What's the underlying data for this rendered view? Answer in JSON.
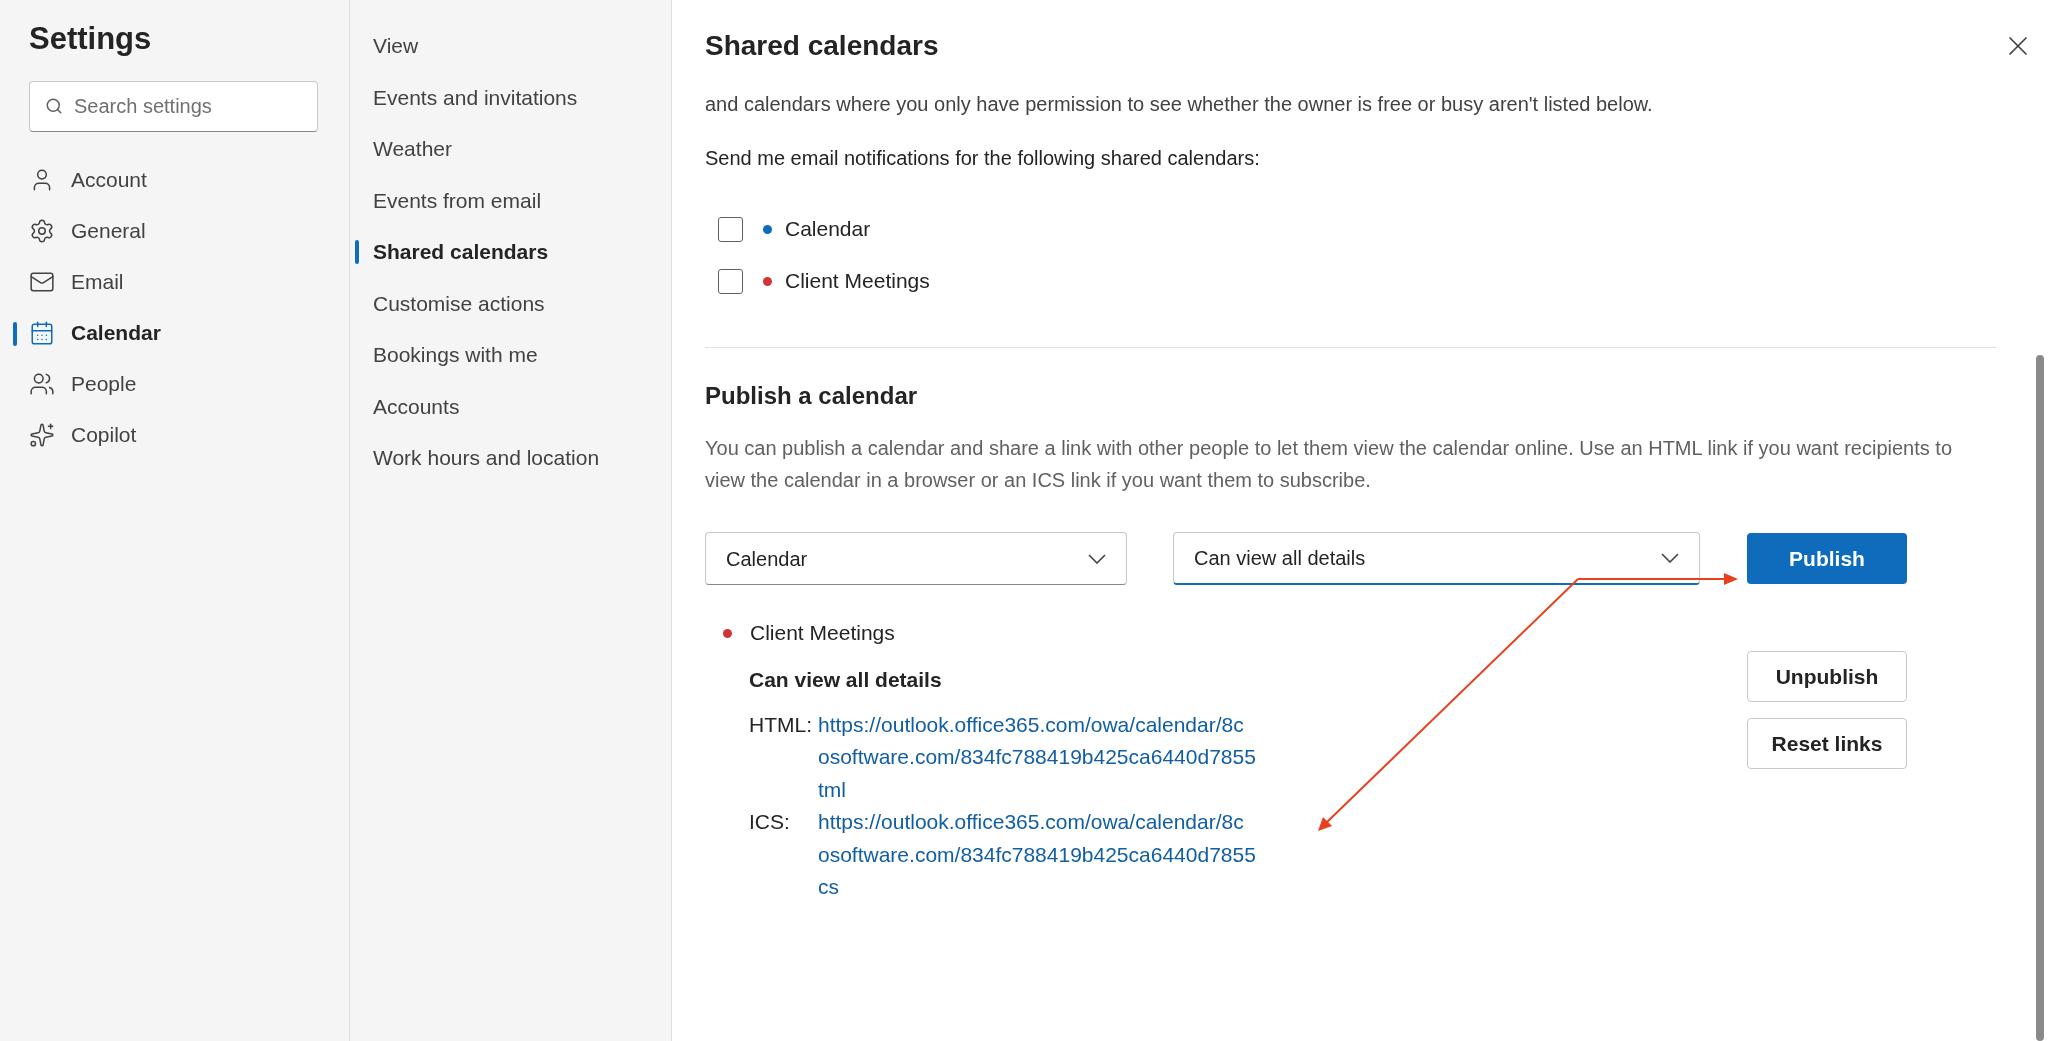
{
  "sidebar": {
    "title": "Settings",
    "search": {
      "placeholder": "Search settings"
    },
    "items": [
      {
        "label": "Account",
        "selected": false
      },
      {
        "label": "General",
        "selected": false
      },
      {
        "label": "Email",
        "selected": false
      },
      {
        "label": "Calendar",
        "selected": true
      },
      {
        "label": "People",
        "selected": false
      },
      {
        "label": "Copilot",
        "selected": false
      }
    ]
  },
  "subnav": {
    "items": [
      {
        "label": "View",
        "selected": false
      },
      {
        "label": "Events and invitations",
        "selected": false
      },
      {
        "label": "Weather",
        "selected": false
      },
      {
        "label": "Events from email",
        "selected": false
      },
      {
        "label": "Shared calendars",
        "selected": true
      },
      {
        "label": "Customise actions",
        "selected": false
      },
      {
        "label": "Bookings with me",
        "selected": false
      },
      {
        "label": "Accounts",
        "selected": false
      },
      {
        "label": "Work hours and location",
        "selected": false
      }
    ]
  },
  "panel": {
    "title": "Shared calendars",
    "notifications": {
      "intro_lines": [
        "and calendars where you only have permission to see whether the owner is free or busy aren't listed below."
      ],
      "prompt": "Send me email notifications for the following shared calendars:",
      "calendars": [
        {
          "name": "Calendar",
          "checked": false,
          "color": "#0f6cbd"
        },
        {
          "name": "Client Meetings",
          "checked": false,
          "color": "#d13438"
        }
      ]
    },
    "publish": {
      "heading": "Publish a calendar",
      "description": "You can publish a calendar and share a link with other people to let them view the calendar online. Use an HTML link if you want recipients to view the calendar in a browser or an ICS link if you want them to subscribe.",
      "calendar_select": {
        "value": "Calendar"
      },
      "permission_select": {
        "value": "Can view all details",
        "focused": true
      },
      "publish_button": "Publish",
      "published": [
        {
          "name": "Client Meetings",
          "color": "#d13438",
          "permission": "Can view all details",
          "links": [
            {
              "label": "HTML:",
              "lines": [
                "https://outlook.office365.com/owa/calendar/8c",
                "osoftware.com/834fc788419b425ca6440d7855",
                "tml"
              ]
            },
            {
              "label": "ICS:",
              "lines": [
                "https://outlook.office365.com/owa/calendar/8c",
                "osoftware.com/834fc788419b425ca6440d7855",
                "cs"
              ]
            }
          ],
          "buttons": [
            "Unpublish",
            "Reset links"
          ]
        }
      ]
    }
  }
}
